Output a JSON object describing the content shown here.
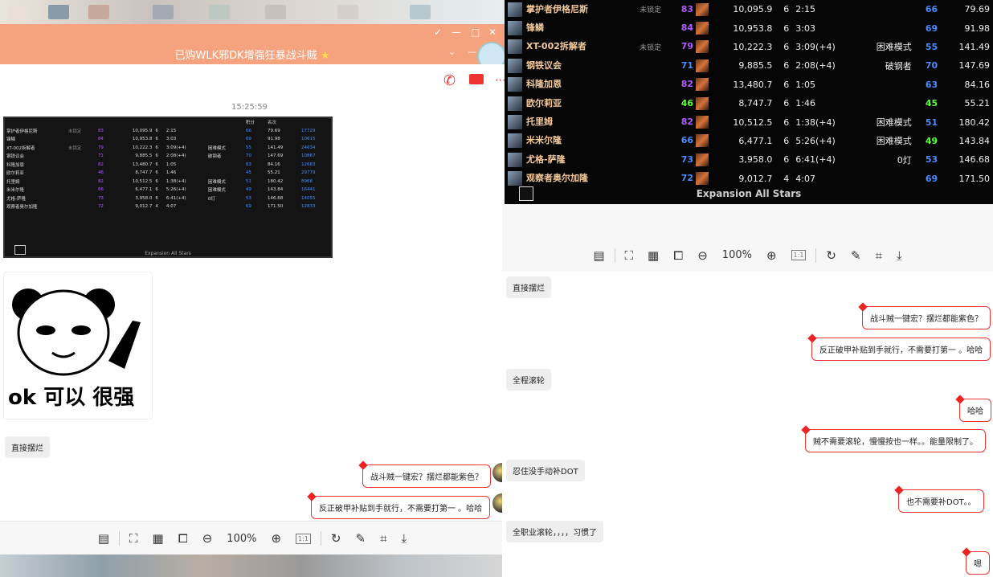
{
  "left_window": {
    "title": "已购WLK邪DK增强狂暴战斗贼",
    "timestamp": "15:25:59",
    "controls": [
      "✓",
      "—",
      "□",
      "✕"
    ],
    "meme_caption": "ok 可以 很强",
    "messages": [
      {
        "side": "left",
        "text": "直接摆烂"
      },
      {
        "side": "right",
        "text": "战斗贼一键宏？摆烂都能紫色？"
      },
      {
        "side": "right",
        "text": "反正破甲补贴到手就行，不需要打第一 。哈哈"
      }
    ],
    "mini_table": {
      "rows": [
        {
          "name": "掌护者伊格尼斯",
          "tag": "未锁定",
          "ilvl": "83",
          "dps": "10,095.9",
          "n": "6",
          "time": "2:15",
          "mode": "",
          "p": "66",
          "score": "79.69",
          "rank": "17729"
        },
        {
          "name": "锋鳞",
          "tag": "",
          "ilvl": "84",
          "dps": "10,953.8",
          "n": "6",
          "time": "3:03",
          "mode": "",
          "p": "69",
          "score": "91.98",
          "rank": "10615"
        },
        {
          "name": "XT-002拆解者",
          "tag": "未锁定",
          "ilvl": "79",
          "dps": "10,222.3",
          "n": "6",
          "time": "3:09(+4)",
          "mode": "困难模式",
          "p": "55",
          "score": "141.49",
          "rank": "24634"
        },
        {
          "name": "钢铁议会",
          "tag": "",
          "ilvl": "71",
          "dps": "9,885.5",
          "n": "6",
          "time": "2:08(+4)",
          "mode": "破钢者",
          "p": "70",
          "score": "147.69",
          "rank": "10867"
        },
        {
          "name": "科隆加恩",
          "tag": "",
          "ilvl": "82",
          "dps": "13,480.7",
          "n": "6",
          "time": "1:05",
          "mode": "",
          "p": "63",
          "score": "84.16",
          "rank": "12683"
        },
        {
          "name": "欧尔莉亚",
          "tag": "",
          "ilvl": "46",
          "dps": "8,747.7",
          "n": "6",
          "time": "1:46",
          "mode": "",
          "p": "45",
          "score": "55.21",
          "rank": "29779"
        },
        {
          "name": "托里姆",
          "tag": "",
          "ilvl": "82",
          "dps": "10,512.5",
          "n": "6",
          "time": "1:38(+4)",
          "mode": "困难模式",
          "p": "51",
          "score": "180.42",
          "rank": "8968"
        },
        {
          "name": "米米尔隆",
          "tag": "",
          "ilvl": "66",
          "dps": "6,477.1",
          "n": "6",
          "time": "5:26(+4)",
          "mode": "困难模式",
          "p": "49",
          "score": "143.84",
          "rank": "16441"
        },
        {
          "name": "尤格-萨隆",
          "tag": "",
          "ilvl": "73",
          "dps": "3,958.0",
          "n": "6",
          "time": "6:41(+4)",
          "mode": "0灯",
          "p": "53",
          "score": "146.68",
          "rank": "14055"
        },
        {
          "name": "观察者奥尔加隆",
          "tag": "",
          "ilvl": "72",
          "dps": "9,012.7",
          "n": "4",
          "time": "4:07",
          "mode": "",
          "p": "69",
          "score": "171.50",
          "rank": "12833"
        }
      ],
      "footer": "Expansion All Stars",
      "header_cells": [
        "积分",
        "名次"
      ]
    }
  },
  "toolbar": {
    "zoom": "100%",
    "one_to_one": "1:1"
  },
  "big_table": {
    "footer": "Expansion All Stars",
    "rows": [
      {
        "name": "掌护者伊格尼斯",
        "tag": "未锁定",
        "ilvl": "83",
        "dps": "10,095.9",
        "n": "6",
        "time": "2:15",
        "mode": "",
        "p": "66",
        "score": "79.69",
        "ilvl_color": "#b15cff",
        "p_color": "#4a8cff"
      },
      {
        "name": "锋鳞",
        "tag": "",
        "ilvl": "84",
        "dps": "10,953.8",
        "n": "6",
        "time": "3:03",
        "mode": "",
        "p": "69",
        "score": "91.98",
        "ilvl_color": "#b15cff",
        "p_color": "#4a8cff"
      },
      {
        "name": "XT-002拆解者",
        "tag": "未锁定",
        "ilvl": "79",
        "dps": "10,222.3",
        "n": "6",
        "time": "3:09(+4)",
        "mode": "困难模式",
        "p": "55",
        "score": "141.49",
        "ilvl_color": "#b15cff",
        "p_color": "#4a8cff"
      },
      {
        "name": "钢铁议会",
        "tag": "",
        "ilvl": "71",
        "dps": "9,885.5",
        "n": "6",
        "time": "2:08(+4)",
        "mode": "破钢者",
        "p": "70",
        "score": "147.69",
        "ilvl_color": "#4a8cff",
        "p_color": "#4a8cff"
      },
      {
        "name": "科隆加恩",
        "tag": "",
        "ilvl": "82",
        "dps": "13,480.7",
        "n": "6",
        "time": "1:05",
        "mode": "",
        "p": "63",
        "score": "84.16",
        "ilvl_color": "#b15cff",
        "p_color": "#4a8cff"
      },
      {
        "name": "欧尔莉亚",
        "tag": "",
        "ilvl": "46",
        "dps": "8,747.7",
        "n": "6",
        "time": "1:46",
        "mode": "",
        "p": "45",
        "score": "55.21",
        "ilvl_color": "#5dff3d",
        "p_color": "#5dff3d"
      },
      {
        "name": "托里姆",
        "tag": "",
        "ilvl": "82",
        "dps": "10,512.5",
        "n": "6",
        "time": "1:38(+4)",
        "mode": "困难模式",
        "p": "51",
        "score": "180.42",
        "ilvl_color": "#b15cff",
        "p_color": "#4a8cff"
      },
      {
        "name": "米米尔隆",
        "tag": "",
        "ilvl": "66",
        "dps": "6,477.1",
        "n": "6",
        "time": "5:26(+4)",
        "mode": "困难模式",
        "p": "49",
        "score": "143.84",
        "ilvl_color": "#4a8cff",
        "p_color": "#5dff3d"
      },
      {
        "name": "尤格-萨隆",
        "tag": "",
        "ilvl": "73",
        "dps": "3,958.0",
        "n": "6",
        "time": "6:41(+4)",
        "mode": "0灯",
        "p": "53",
        "score": "146.68",
        "ilvl_color": "#4a8cff",
        "p_color": "#4a8cff"
      },
      {
        "name": "观察者奥尔加隆",
        "tag": "",
        "ilvl": "72",
        "dps": "9,012.7",
        "n": "4",
        "time": "4:07",
        "mode": "",
        "p": "69",
        "score": "171.50",
        "ilvl_color": "#4a8cff",
        "p_color": "#4a8cff"
      }
    ]
  },
  "right_chat": {
    "messages": [
      {
        "side": "left",
        "text": "直接摆烂"
      },
      {
        "side": "right",
        "text": "战斗贼一键宏？摆烂都能紫色？"
      },
      {
        "side": "right",
        "text": "反正破甲补贴到手就行，不需要打第一 。哈哈"
      },
      {
        "side": "left",
        "text": "全程滚轮"
      },
      {
        "side": "right",
        "text": "哈哈"
      },
      {
        "side": "right",
        "text": "贼不需要滚轮，慢慢按也一样。。能量限制了。"
      },
      {
        "side": "left",
        "text": "忍住没手动补DOT"
      },
      {
        "side": "right",
        "text": "也不需要补DOT。。"
      },
      {
        "side": "left",
        "text": "全职业滚轮，，，，习惯了"
      },
      {
        "side": "right",
        "text": "嗯"
      }
    ]
  }
}
